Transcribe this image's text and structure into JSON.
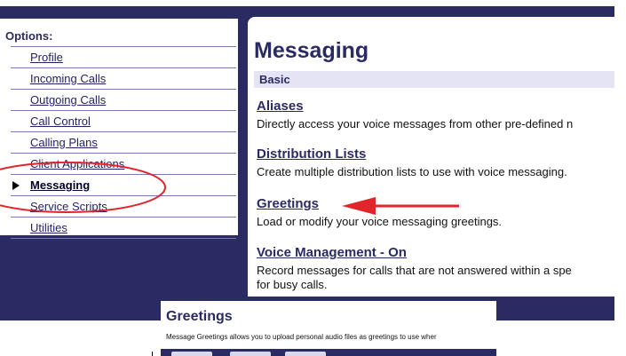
{
  "options": {
    "title": "Options:",
    "items": [
      {
        "label": "Profile"
      },
      {
        "label": "Incoming Calls"
      },
      {
        "label": "Outgoing Calls"
      },
      {
        "label": "Call Control"
      },
      {
        "label": "Calling Plans"
      },
      {
        "label": "Client Applications"
      },
      {
        "label": "Messaging",
        "active": true
      },
      {
        "label": "Service Scripts"
      },
      {
        "label": "Utilities"
      }
    ]
  },
  "main": {
    "title": "Messaging",
    "basic_label": "Basic",
    "sections": [
      {
        "title": "Aliases",
        "desc": "Directly access your voice messages from other pre-defined n"
      },
      {
        "title": "Distribution Lists",
        "desc": "Create multiple distribution lists to use with voice messaging."
      },
      {
        "title": "Greetings",
        "desc": "Load or modify your voice messaging greetings."
      },
      {
        "title": "Voice Management - On",
        "desc": "Record messages for calls that are not answered within a spe",
        "desc2": "for busy calls."
      }
    ]
  },
  "popup": {
    "title": "Greetings",
    "desc": "Message Greetings allows you to upload personal audio files as greetings to use wher"
  },
  "colors": {
    "navy": "#2b2b63",
    "annotation_red": "#e0262a"
  }
}
